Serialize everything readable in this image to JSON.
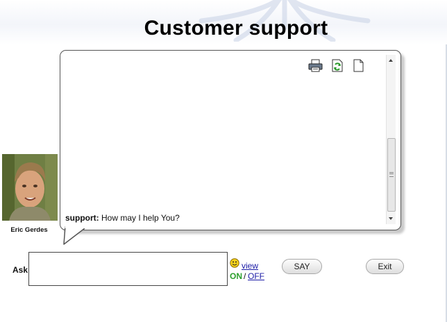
{
  "header": {
    "title": "Customer support"
  },
  "agent": {
    "name": "Eric Gerdes"
  },
  "toolbar": {
    "icons": [
      "print-icon",
      "refresh-icon",
      "new-page-icon"
    ]
  },
  "chat": {
    "messages": [
      {
        "sender": "support:",
        "text": "How may I help You?"
      }
    ]
  },
  "input": {
    "label": "Ask",
    "value": "",
    "placeholder": ""
  },
  "emoticons": {
    "view_label": "view",
    "on_label": "ON",
    "separator": "/",
    "off_label": "OFF"
  },
  "buttons": {
    "say_label": "SAY",
    "exit_label": "Exit"
  },
  "colors": {
    "on": "#2ca02c",
    "link": "#1a1aa6"
  }
}
